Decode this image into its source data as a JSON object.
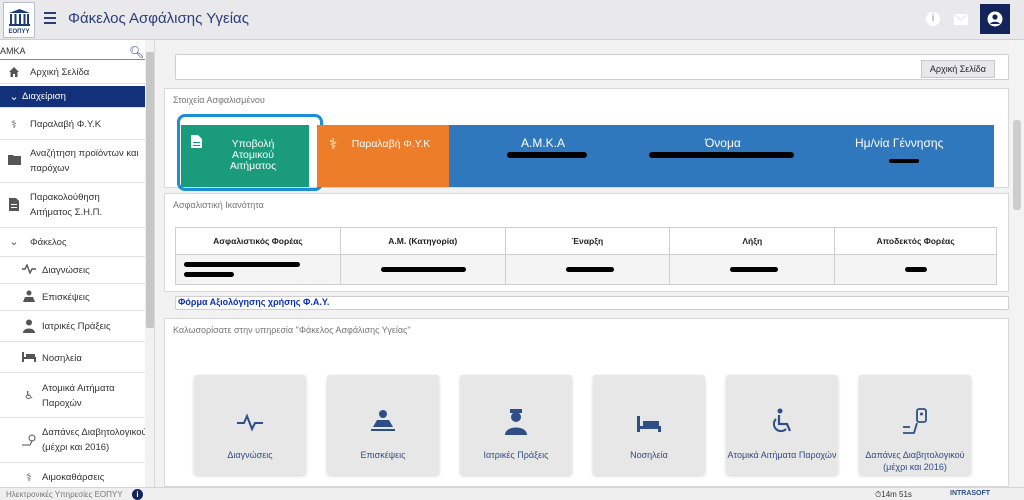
{
  "header": {
    "title": "Φάκελος Ασφάλισης Υγείας",
    "logo_text": "ΕΟΠΥΥ"
  },
  "sidebar": {
    "search_placeholder": "ΑΜΚΑ",
    "items": [
      {
        "label": "Αρχική Σελίδα",
        "icon": "home-icon"
      },
      {
        "label": "Διαχείριση",
        "icon": "chevron-down-icon"
      },
      {
        "label": "Παραλαβή Φ.Υ.Κ",
        "icon": "pharmacy-icon"
      },
      {
        "label": "Αναζήτηση προϊόντων και παρόχων",
        "icon": "folder-search-icon"
      },
      {
        "label": "Παρακολούθηση Αιτήματος Σ.Η.Π.",
        "icon": "document-icon"
      },
      {
        "label": "Φάκελος",
        "icon": "chevron-down-icon"
      },
      {
        "label": "Διαγνώσεις",
        "icon": "pulse-icon"
      },
      {
        "label": "Επισκέψεις",
        "icon": "visit-icon"
      },
      {
        "label": "Ιατρικές Πράξεις",
        "icon": "doctor-icon"
      },
      {
        "label": "Νοσηλεία",
        "icon": "bed-icon"
      },
      {
        "label": "Ατομικά Αιτήματα Παροχών",
        "icon": "wheelchair-icon"
      },
      {
        "label": "Δαπάνες Διαβητολογικού (μέχρι και 2016)",
        "icon": "diabetes-icon"
      },
      {
        "label": "Αιμοκαθάρσεις",
        "icon": "dialysis-icon"
      }
    ]
  },
  "breadcrumb": {
    "home_button": "Αρχική Σελίδα"
  },
  "insured": {
    "section_title": "Στοιχεία Ασφαλισμένου",
    "submit_card": "Υποβολή Ατομικού Αιτήματος",
    "receive_card": "Παραλαβή Φ.Υ.Κ",
    "headers": [
      "Α.Μ.Κ.Α",
      "Όνομα",
      "Ημ/νία Γέννησης"
    ]
  },
  "coverage": {
    "section_title": "Ασφαλιστική Ικανότητα",
    "columns": [
      "Ασφαλιστικός Φορέας",
      "Α.Μ. (Κατηγορία)",
      "Έναρξη",
      "Λήξη",
      "Αποδεκτός Φορέας"
    ]
  },
  "evaluation_link": "Φόρμα Αξιολόγησης χρήσης Φ.Α.Υ.",
  "welcome": {
    "title": "Καλωσορίσατε στην υπηρεσία \"Φάκελος Ασφάλισης Υγείας\"",
    "tiles": [
      {
        "label": "Διαγνώσεις",
        "icon": "pulse-icon"
      },
      {
        "label": "Επισκέψεις",
        "icon": "visit-icon"
      },
      {
        "label": "Ιατρικές Πράξεις",
        "icon": "doctor-icon"
      },
      {
        "label": "Νοσηλεία",
        "icon": "bed-icon"
      },
      {
        "label": "Ατομικά Αιτήματα Παροχών",
        "icon": "wheelchair-icon"
      },
      {
        "label": "Δαπάνες Διαβητολογικού (μέχρι και 2016)",
        "icon": "diabetes-icon"
      }
    ]
  },
  "footer": {
    "left_text": "Ηλεκτρονικές Υπηρεσίες ΕΟΠΥΥ",
    "timer": "14m 51s",
    "brand": "INTRASOFT"
  },
  "colors": {
    "primary_navy": "#13307a",
    "teal": "#1a9b7b",
    "orange": "#ee7d2a",
    "blue": "#2f78bd",
    "highlight_ring": "#1a8fd6"
  }
}
